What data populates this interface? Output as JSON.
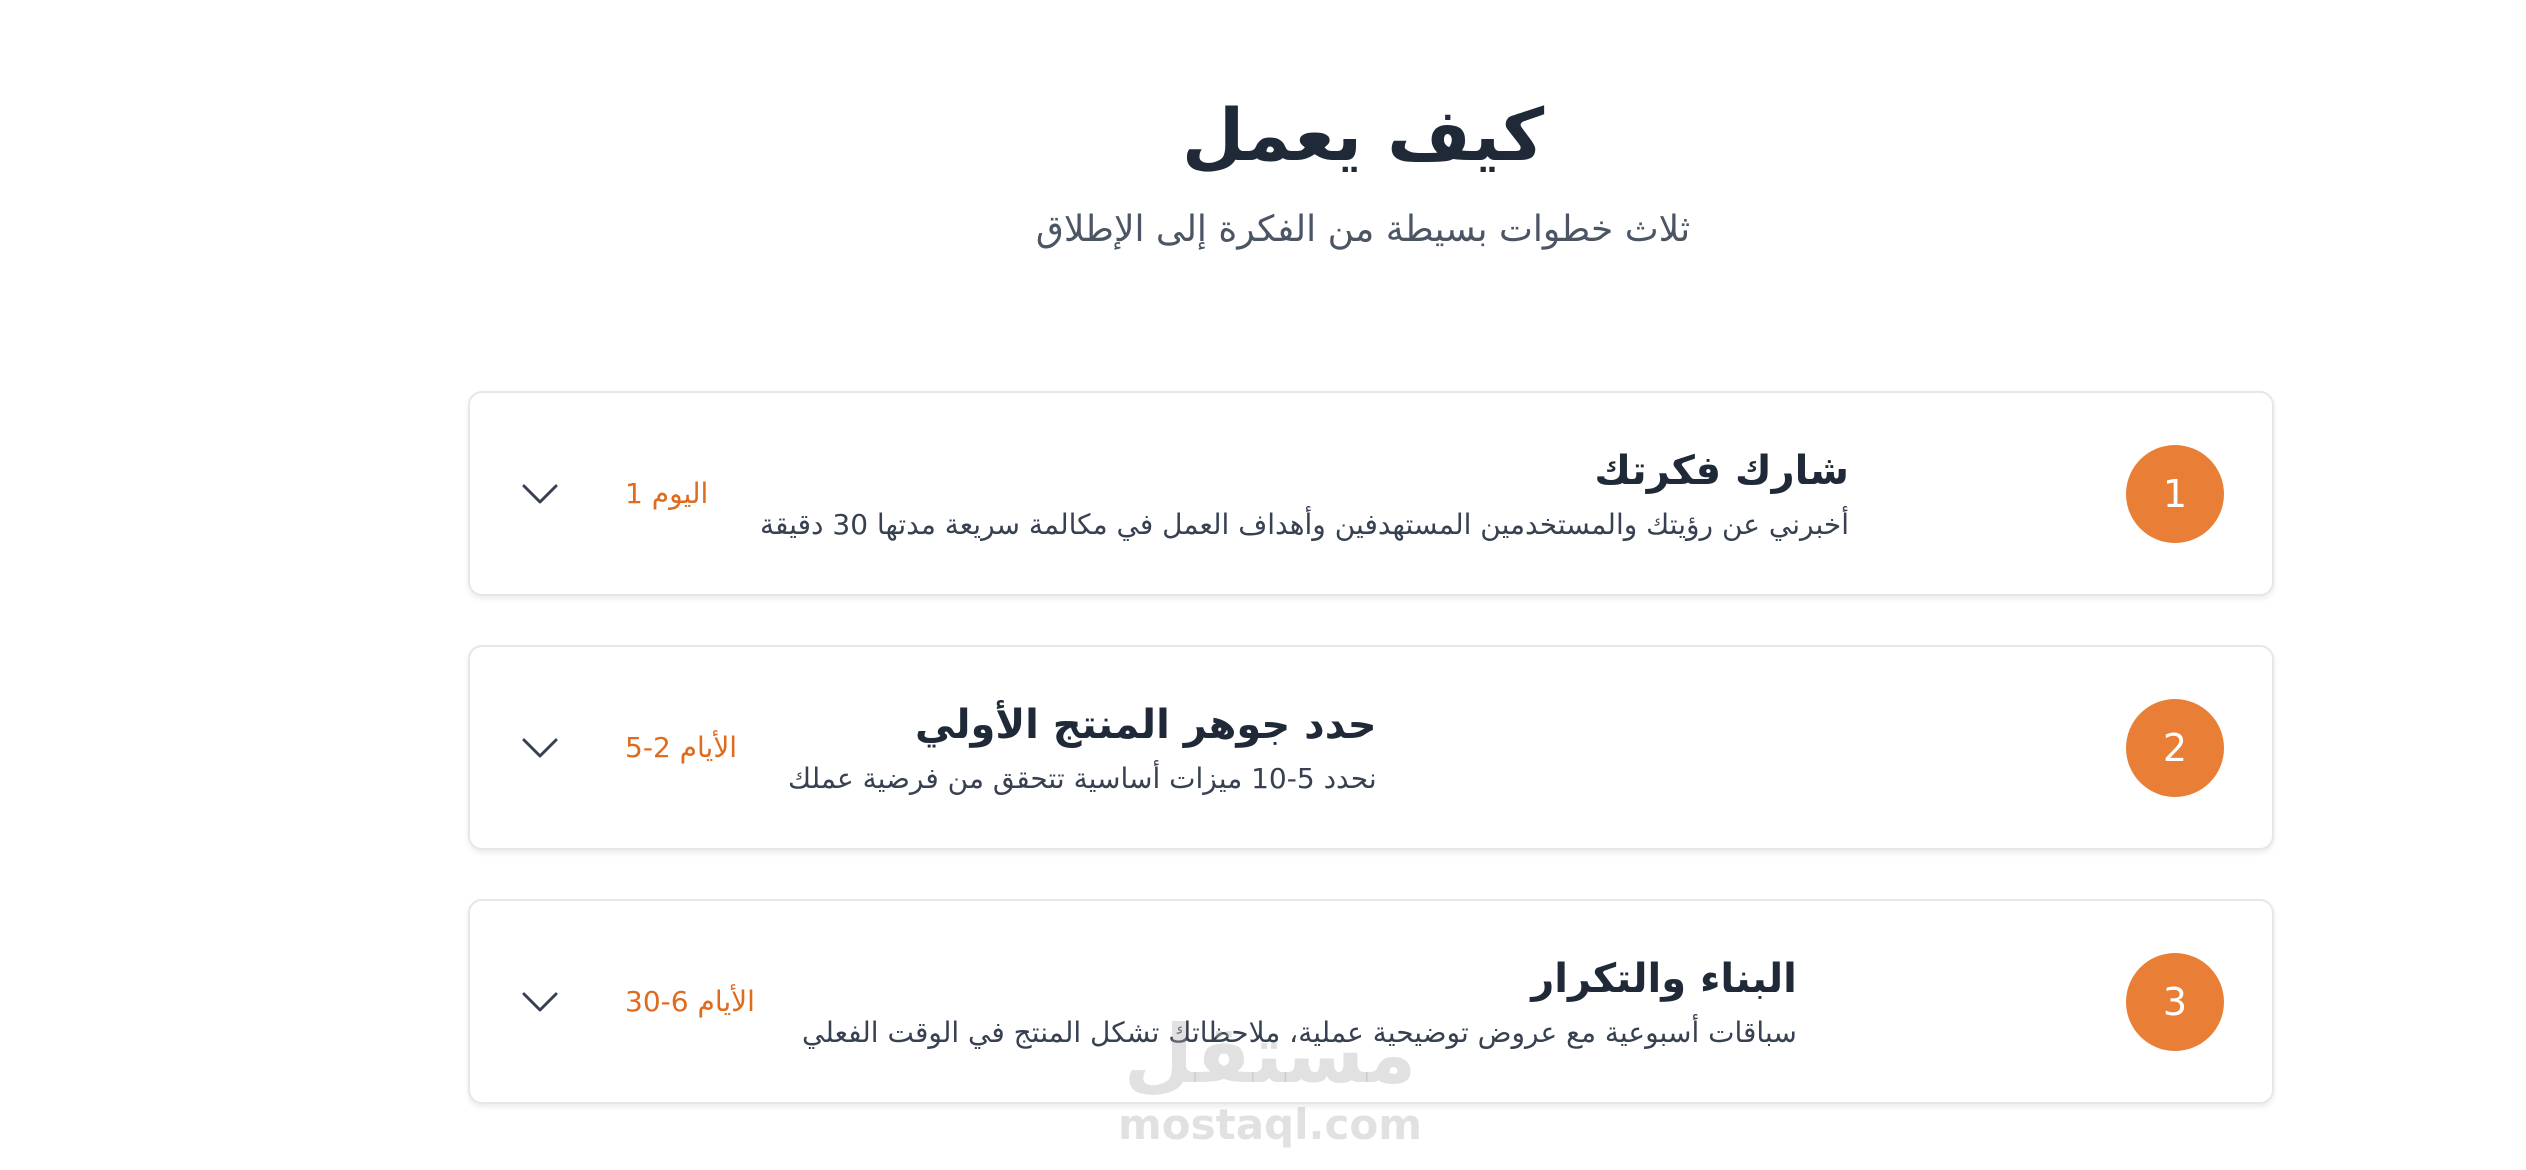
{
  "header": {
    "title": "كيف يعمل",
    "subtitle": "ثلاث خطوات بسيطة من الفكرة إلى الإطلاق"
  },
  "steps": [
    {
      "number": "1",
      "title": "شارك فكرتك",
      "description": "أخبرني عن رؤيتك والمستخدمين المستهدفين وأهداف العمل في مكالمة سريعة مدتها 30 دقيقة",
      "timeframe": "اليوم 1",
      "icon": "chevron-down-icon"
    },
    {
      "number": "2",
      "title": "حدد جوهر المنتج الأولي",
      "description": "نحدد 5-10 ميزات أساسية تتحقق من فرضية عملك",
      "timeframe": "الأيام 2-5",
      "icon": "chevron-down-icon"
    },
    {
      "number": "3",
      "title": "البناء والتكرار",
      "description": "سباقات أسبوعية مع عروض توضيحية عملية، ملاحظاتك تشكل المنتج في الوقت الفعلي",
      "timeframe": "الأيام 6-30",
      "icon": "chevron-down-icon"
    }
  ],
  "watermark": {
    "arabic": "مستقل",
    "latin": "mostaql.com"
  },
  "colors": {
    "accent": "#e97f37",
    "timeframe": "#e16b1d",
    "title": "#1f2937",
    "border": "#e5e7eb"
  }
}
